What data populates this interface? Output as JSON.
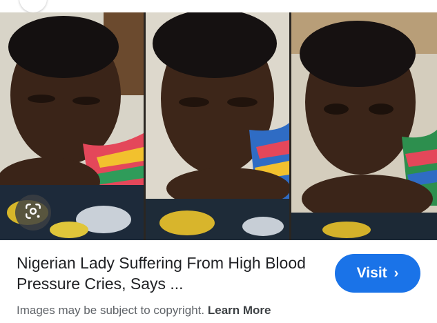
{
  "result": {
    "title": "Nigerian Lady Suffering From High Blood Pressure Cries, Says ...",
    "visit_label": "Visit",
    "visit_chevron": "›",
    "copyright_text": "Images may be subject to copyright.",
    "learn_more_label": "Learn More"
  },
  "icons": {
    "lens": "google-lens-icon",
    "chevron": "chevron-right-icon"
  },
  "colors": {
    "visit_button": "#1a73e8",
    "title_text": "#202124",
    "muted_text": "#5f6368"
  }
}
